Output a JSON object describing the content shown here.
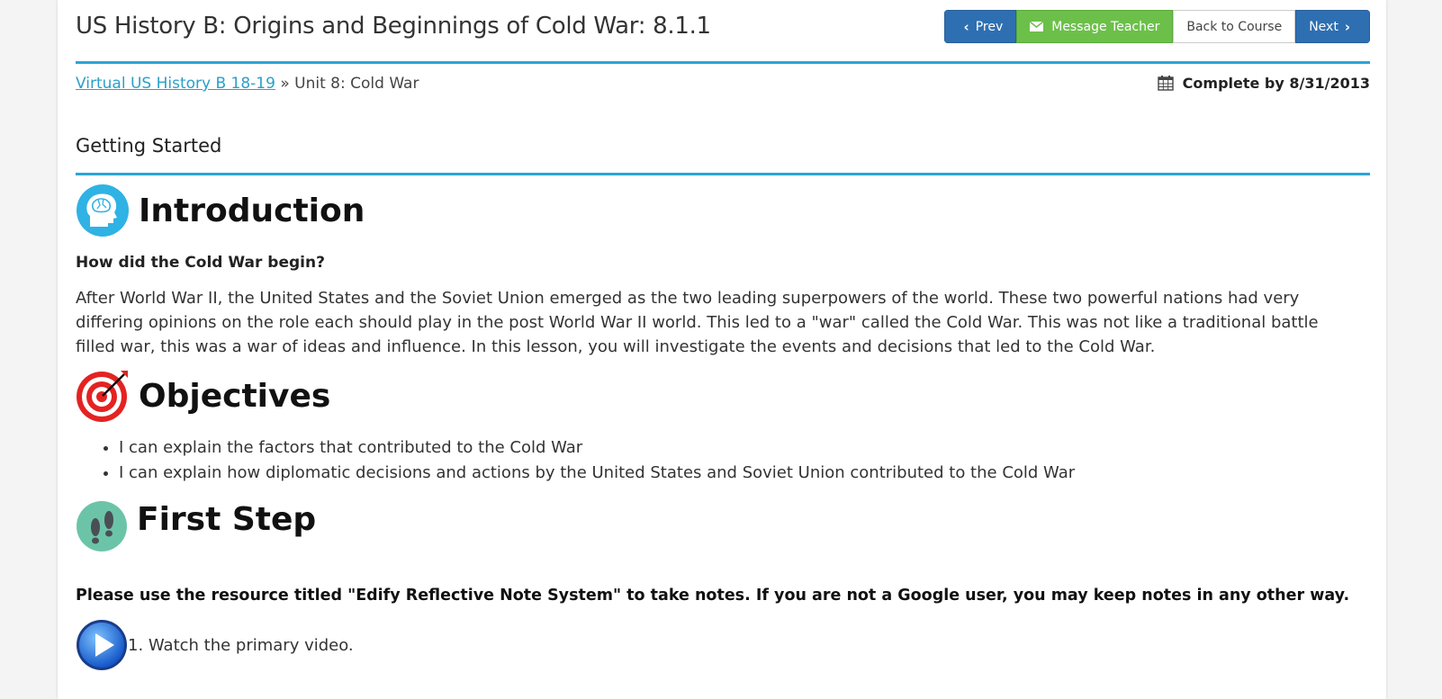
{
  "header": {
    "title": "US History B: Origins and Beginnings of Cold War: 8.1.1",
    "buttons": {
      "prev": "Prev",
      "message": "Message Teacher",
      "back": "Back to Course",
      "next": "Next"
    }
  },
  "breadcrumb": {
    "course_link": "Virtual US History B 18-19",
    "separator": "»",
    "unit": "Unit 8: Cold War"
  },
  "due": {
    "label": "Complete by 8/31/2013"
  },
  "section": {
    "title": "Getting Started"
  },
  "introduction": {
    "heading": "Introduction",
    "question": "How did the Cold War begin?",
    "paragraph": "After World War II, the United States and the Soviet Union emerged as the two leading superpowers of the world.  These two powerful nations had very differing opinions on the role each should play in the post World War II world.  This led to a \"war\" called the Cold War.  This was not like a traditional battle filled war, this was a war of ideas and influence.  In this lesson, you will investigate the events and decisions that led to the Cold War."
  },
  "objectives": {
    "heading": "Objectives",
    "items": [
      "I can explain the factors that contributed to the Cold War",
      "I can explain how diplomatic decisions and actions by the United States and Soviet Union contributed to the Cold War"
    ]
  },
  "first_step": {
    "heading": "First Step",
    "notes": "Please use the resource titled \"Edify Reflective Note System\" to take notes.  If you are not a Google user, you may keep notes in any other way.",
    "step1": "1. Watch the primary video."
  },
  "colors": {
    "accent": "#2aa5d6",
    "prev_next": "#2e6fb2",
    "message": "#6cc04a"
  },
  "icons": {
    "introduction": "brain-head-icon",
    "objectives": "target-icon",
    "first_step": "footprints-icon",
    "step1": "play-icon",
    "due": "calendar-icon"
  }
}
